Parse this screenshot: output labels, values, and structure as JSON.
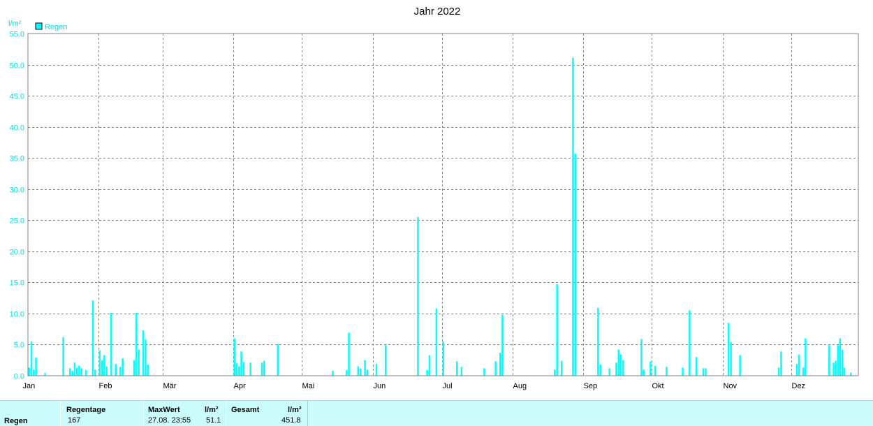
{
  "chart_data": {
    "type": "bar",
    "title": "Jahr 2022",
    "ylabel": "l/m²",
    "ylim": [
      0,
      55
    ],
    "y_ticks": [
      "0.0",
      "5.0",
      "10.0",
      "15.0",
      "20.0",
      "25.0",
      "30.0",
      "35.0",
      "40.0",
      "45.0",
      "50.0",
      "55.0"
    ],
    "x_month_labels": [
      "Jan",
      "Feb",
      "Mär",
      "Apr",
      "Mai",
      "Jun",
      "Jul",
      "Aug",
      "Sep",
      "Okt",
      "Nov",
      "Dez"
    ],
    "legend": {
      "label": "Regen",
      "placement": "top-left"
    },
    "grid": true,
    "series": [
      {
        "name": "Regen",
        "color": "#00ffff",
        "points": [
          {
            "x": "01.01.",
            "y": 1.3
          },
          {
            "x": "02.01.",
            "y": 5.5
          },
          {
            "x": "03.01.",
            "y": 1.0
          },
          {
            "x": "04.01.",
            "y": 2.9
          },
          {
            "x": "08.01.",
            "y": 0.4
          },
          {
            "x": "16.01.",
            "y": 6.2
          },
          {
            "x": "19.01.",
            "y": 1.2
          },
          {
            "x": "20.01.",
            "y": 0.8
          },
          {
            "x": "21.01.",
            "y": 2.1
          },
          {
            "x": "22.01.",
            "y": 1.3
          },
          {
            "x": "23.01.",
            "y": 1.6
          },
          {
            "x": "24.01.",
            "y": 1.2
          },
          {
            "x": "26.01.",
            "y": 0.9
          },
          {
            "x": "29.01.",
            "y": 12.1
          },
          {
            "x": "30.01.",
            "y": 1.0
          },
          {
            "x": "01.02.",
            "y": 4.1
          },
          {
            "x": "02.02.",
            "y": 2.5
          },
          {
            "x": "03.02.",
            "y": 3.3
          },
          {
            "x": "04.02.",
            "y": 1.5
          },
          {
            "x": "06.02.",
            "y": 10.1
          },
          {
            "x": "08.02.",
            "y": 1.9
          },
          {
            "x": "10.02.",
            "y": 1.4
          },
          {
            "x": "11.02.",
            "y": 2.8
          },
          {
            "x": "16.02.",
            "y": 2.5
          },
          {
            "x": "17.02.",
            "y": 10.1
          },
          {
            "x": "18.02.",
            "y": 4.2
          },
          {
            "x": "20.02.",
            "y": 7.3
          },
          {
            "x": "21.02.",
            "y": 5.8
          },
          {
            "x": "22.02.",
            "y": 1.8
          },
          {
            "x": "01.04.",
            "y": 6.0
          },
          {
            "x": "02.04.",
            "y": 2.0
          },
          {
            "x": "03.04.",
            "y": 1.5
          },
          {
            "x": "04.04.",
            "y": 3.9
          },
          {
            "x": "05.04.",
            "y": 2.2
          },
          {
            "x": "08.04.",
            "y": 2.1
          },
          {
            "x": "13.04.",
            "y": 2.1
          },
          {
            "x": "14.04.",
            "y": 2.4
          },
          {
            "x": "20.04.",
            "y": 5.1
          },
          {
            "x": "14.05.",
            "y": 0.8
          },
          {
            "x": "20.05.",
            "y": 0.9
          },
          {
            "x": "21.05.",
            "y": 6.9
          },
          {
            "x": "25.05.",
            "y": 1.5
          },
          {
            "x": "26.05.",
            "y": 1.2
          },
          {
            "x": "28.05.",
            "y": 2.5
          },
          {
            "x": "29.05.",
            "y": 1.0
          },
          {
            "x": "02.06.",
            "y": 1.9
          },
          {
            "x": "06.06.",
            "y": 5.0
          },
          {
            "x": "20.06.",
            "y": 25.5
          },
          {
            "x": "24.06.",
            "y": 0.9
          },
          {
            "x": "25.06.",
            "y": 3.3
          },
          {
            "x": "28.06.",
            "y": 10.8
          },
          {
            "x": "01.07.",
            "y": 5.5
          },
          {
            "x": "07.07.",
            "y": 2.3
          },
          {
            "x": "09.07.",
            "y": 1.4
          },
          {
            "x": "19.07.",
            "y": 1.2
          },
          {
            "x": "24.07.",
            "y": 2.3
          },
          {
            "x": "26.07.",
            "y": 3.7
          },
          {
            "x": "27.07.",
            "y": 9.8
          },
          {
            "x": "19.08.",
            "y": 1.0
          },
          {
            "x": "20.08.",
            "y": 14.7
          },
          {
            "x": "22.08.",
            "y": 2.4
          },
          {
            "x": "27.08.",
            "y": 51.1
          },
          {
            "x": "28.08.",
            "y": 35.7
          },
          {
            "x": "07.09.",
            "y": 10.9
          },
          {
            "x": "08.09.",
            "y": 1.8
          },
          {
            "x": "12.09.",
            "y": 1.2
          },
          {
            "x": "15.09.",
            "y": 2.1
          },
          {
            "x": "16.09.",
            "y": 4.2
          },
          {
            "x": "17.09.",
            "y": 3.4
          },
          {
            "x": "18.09.",
            "y": 2.5
          },
          {
            "x": "26.09.",
            "y": 5.9
          },
          {
            "x": "27.09.",
            "y": 1.0
          },
          {
            "x": "30.09.",
            "y": 2.3
          },
          {
            "x": "02.10.",
            "y": 1.6
          },
          {
            "x": "07.10.",
            "y": 1.4
          },
          {
            "x": "14.10.",
            "y": 1.3
          },
          {
            "x": "17.10.",
            "y": 10.5
          },
          {
            "x": "20.10.",
            "y": 3.0
          },
          {
            "x": "23.10.",
            "y": 1.2
          },
          {
            "x": "24.10.",
            "y": 1.2
          },
          {
            "x": "03.11.",
            "y": 8.5
          },
          {
            "x": "04.11.",
            "y": 5.4
          },
          {
            "x": "08.11.",
            "y": 3.3
          },
          {
            "x": "25.11.",
            "y": 1.3
          },
          {
            "x": "26.11.",
            "y": 3.9
          },
          {
            "x": "03.12.",
            "y": 1.9
          },
          {
            "x": "04.12.",
            "y": 3.4
          },
          {
            "x": "06.12.",
            "y": 1.3
          },
          {
            "x": "07.12.",
            "y": 6.0
          },
          {
            "x": "18.12.",
            "y": 4.9
          },
          {
            "x": "20.12.",
            "y": 2.1
          },
          {
            "x": "21.12.",
            "y": 2.4
          },
          {
            "x": "22.12.",
            "y": 4.9
          },
          {
            "x": "23.12.",
            "y": 6.0
          },
          {
            "x": "24.12.",
            "y": 4.2
          },
          {
            "x": "25.12.",
            "y": 1.3
          },
          {
            "x": "28.12.",
            "y": 0.5
          }
        ]
      }
    ]
  },
  "stats": {
    "row_label": "Regen",
    "regentage_header": "Regentage",
    "regentage_value": "167",
    "maxwert_header": "MaxWert",
    "maxwert_unit": "l/m²",
    "maxwert_date": "27.08.  23:55",
    "maxwert_value": "51.1",
    "gesamt_header": "Gesamt",
    "gesamt_unit": "l/m²",
    "gesamt_value": "451.8"
  }
}
